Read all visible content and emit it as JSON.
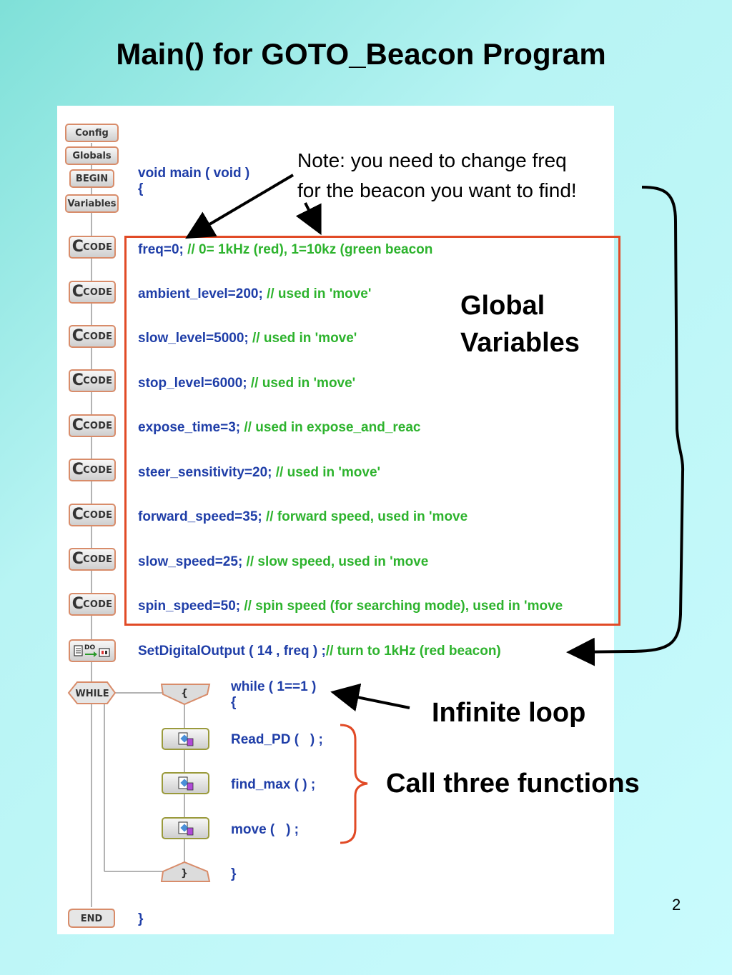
{
  "slide": {
    "title": "Main() for GOTO_Beacon Program",
    "page_number": "2"
  },
  "annotations": {
    "note_line1": "Note: you need to change freq",
    "note_line2": "for the beacon you want to find!",
    "global_line1": "Global",
    "global_line2": "Variables",
    "infinite_loop": "Infinite loop",
    "call_functions": "Call three functions"
  },
  "blocks": {
    "config": "Config",
    "globals": "Globals",
    "begin": "BEGIN",
    "variables": "Variables",
    "code_c": "C",
    "code_label": "CODE",
    "do_label": "DO",
    "while": "WHILE",
    "brace_open": "{",
    "brace_close": "}",
    "end": "END"
  },
  "code": {
    "main_decl": "void main ( void )",
    "main_open": "{",
    "lines": [
      {
        "stmt": "freq=0;",
        "comment": " // 0= 1kHz (red), 1=10kz (green beacon"
      },
      {
        "stmt": "ambient_level=200;",
        "comment": " // used in 'move'"
      },
      {
        "stmt": "slow_level=5000;",
        "comment": " // used in 'move'"
      },
      {
        "stmt": "stop_level=6000;",
        "comment": " // used in 'move'"
      },
      {
        "stmt": "expose_time=3;",
        "comment": " // used in expose_and_reac"
      },
      {
        "stmt": "steer_sensitivity=20;",
        "comment": " // used in 'move'"
      },
      {
        "stmt": "forward_speed=35;",
        "comment": " // forward speed, used in 'move"
      },
      {
        "stmt": "slow_speed=25;",
        "comment": " // slow speed, used in 'move"
      },
      {
        "stmt": "spin_speed=50;",
        "comment": " // spin speed (for searching mode), used in 'move"
      }
    ],
    "set_output": "SetDigitalOutput ( 14 , freq ) ;",
    "set_output_comment": "// turn to 1kHz (red beacon)",
    "while_decl": "while ( 1==1 )",
    "while_open": "{",
    "call1": "Read_PD (   ) ;",
    "call2": "find_max ( ) ;",
    "call3": "move (   ) ;",
    "while_close": "}",
    "main_close": "}"
  },
  "colors": {
    "keyword": "#1f3ea8",
    "comment": "#2db32d",
    "highlight_box": "#e14a26"
  }
}
